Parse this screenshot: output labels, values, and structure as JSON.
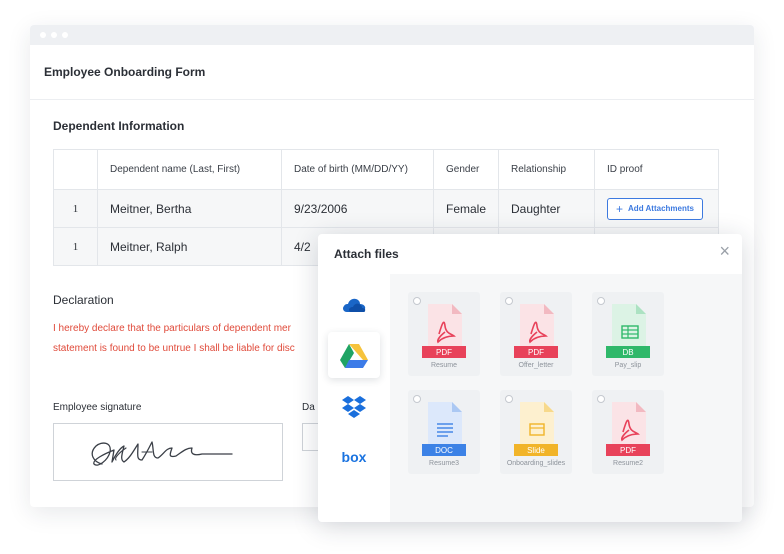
{
  "form": {
    "title": "Employee Onboarding Form",
    "section_title": "Dependent Information",
    "columns": [
      "Dependent name (Last, First)",
      "Date of birth (MM/DD/YY)",
      "Gender",
      "Relationship",
      "ID proof"
    ],
    "rows": [
      {
        "index": "1",
        "name": "Meitner, Bertha",
        "dob": "9/23/2006",
        "gender": "Female",
        "relationship": "Daughter"
      },
      {
        "index": "1",
        "name": "Meitner, Ralph",
        "dob": "4/2",
        "gender": "",
        "relationship": ""
      }
    ],
    "attach_button_label": "Add Attachments",
    "declaration_title": "Declaration",
    "declaration_line1": "I hereby declare that the particulars of dependent mer",
    "declaration_line2": "statement is found to be untrue I shall be liable for disc",
    "signature_label": "Employee signature",
    "date_label": "Da"
  },
  "modal": {
    "title": "Attach files",
    "close_glyph": "×",
    "providers": [
      "onedrive-icon",
      "google-drive-icon",
      "dropbox-icon",
      "box-icon"
    ],
    "box_label": "box",
    "files": [
      {
        "type": "PDF",
        "name": "Resume",
        "color": "#e8425a"
      },
      {
        "type": "PDF",
        "name": "Offer_letter",
        "color": "#e8425a"
      },
      {
        "type": "DB",
        "name": "Pay_slip",
        "color": "#2fb86a"
      },
      {
        "type": "DOC",
        "name": "Resume3",
        "color": "#3c82e6"
      },
      {
        "type": "Slide",
        "name": "Onboarding_slides",
        "color": "#f1b429"
      },
      {
        "type": "PDF",
        "name": "Resume2",
        "color": "#e8425a"
      }
    ]
  },
  "colors": {
    "accent": "#3d7ae0",
    "declaration": "#e04a3a"
  }
}
